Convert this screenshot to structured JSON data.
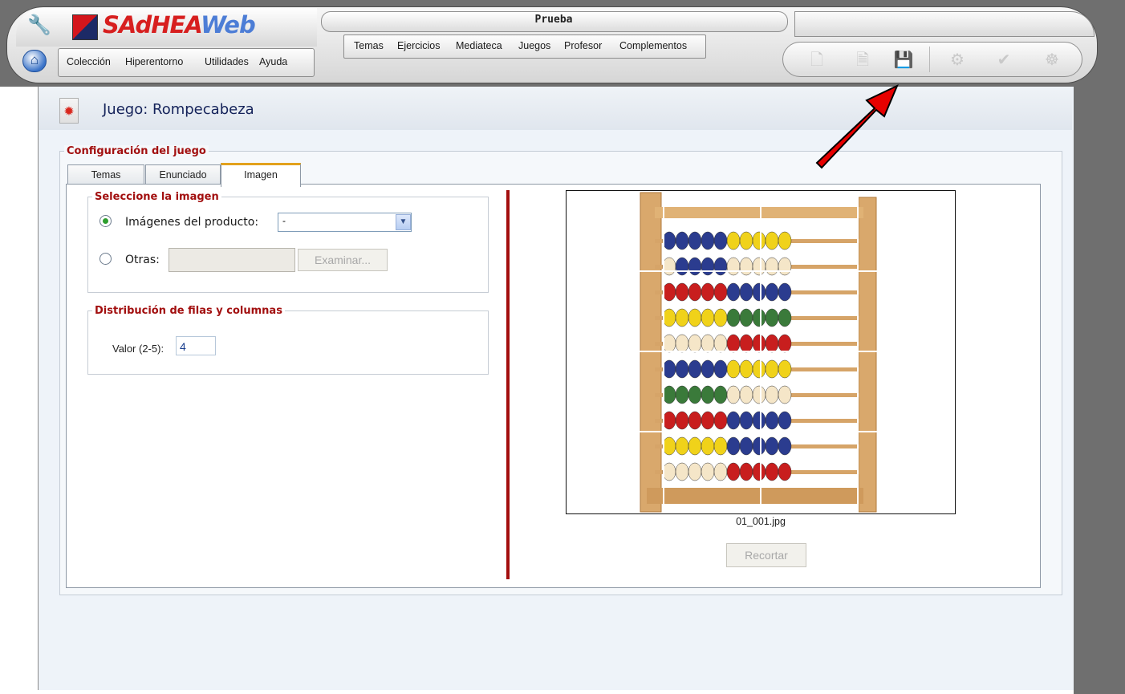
{
  "app": {
    "logo_text_1": "SAdHEA",
    "logo_text_2": "Web",
    "document_title": "Prueba"
  },
  "left_menu": {
    "items": [
      "Colección",
      "Hiperentorno",
      "Utilidades",
      "Ayuda"
    ]
  },
  "center_menu": {
    "items": [
      "Temas",
      "Ejercicios",
      "Mediateca",
      "Juegos",
      "Profesor",
      "Complementos"
    ]
  },
  "toolbar": {
    "icons": [
      "new-document-icon",
      "edit-document-icon",
      "save-icon",
      "settings-icon",
      "check-icon",
      "config-icon"
    ]
  },
  "page": {
    "title": "Juego: Rompecabeza"
  },
  "config": {
    "legend": "Configuración del juego",
    "tabs": [
      "Temas",
      "Enunciado",
      "Imagen"
    ],
    "active_tab": "Imagen",
    "image_section": {
      "legend": "Seleccione la imagen",
      "product_images_label": "Imágenes del producto:",
      "product_images_value": "-",
      "other_label": "Otras:",
      "browse_label": "Examinar..."
    },
    "distribution_section": {
      "legend": "Distribución de filas y columnas",
      "value_label": "Valor (2-5):",
      "value": "4"
    },
    "preview": {
      "filename": "01_001.jpg",
      "crop_label": "Recortar"
    }
  },
  "colors": {
    "accent_red": "#a30e0e",
    "title_blue": "#15235a"
  }
}
